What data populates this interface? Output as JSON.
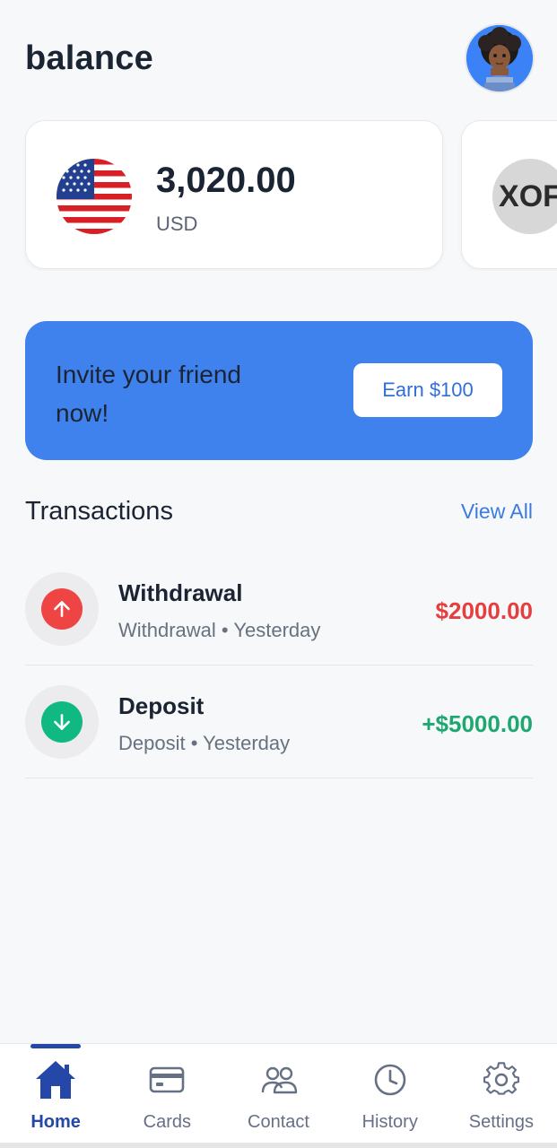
{
  "header": {
    "title": "balance",
    "avatar_icon": "user-avatar"
  },
  "balances": [
    {
      "amount": "3,020.00",
      "currency": "USD",
      "icon": "us-flag-icon"
    },
    {
      "label": "XOF",
      "icon": "xof-coin-icon"
    }
  ],
  "invite": {
    "text": "Invite your friend now!",
    "button_label": "Earn $100"
  },
  "transactions": {
    "title": "Transactions",
    "view_all_label": "View All",
    "items": [
      {
        "name": "Withdrawal",
        "subtitle": "Withdrawal • Yesterday",
        "amount": "$2000.00",
        "type": "withdrawal",
        "icon": "arrow-up-icon"
      },
      {
        "name": "Deposit",
        "subtitle": "Deposit • Yesterday",
        "amount": "+$5000.00",
        "type": "deposit",
        "icon": "arrow-down-icon"
      }
    ]
  },
  "nav": {
    "active": "home",
    "items": [
      {
        "label": "Home",
        "icon": "home-icon"
      },
      {
        "label": "Cards",
        "icon": "card-icon"
      },
      {
        "label": "Contact",
        "icon": "users-icon"
      },
      {
        "label": "History",
        "icon": "clock-icon"
      },
      {
        "label": "Settings",
        "icon": "gear-icon"
      }
    ]
  },
  "colors": {
    "accent": "#3f82ee",
    "nav_active": "#2547a8",
    "negative": "#e53e3e",
    "positive": "#1ca86f"
  }
}
